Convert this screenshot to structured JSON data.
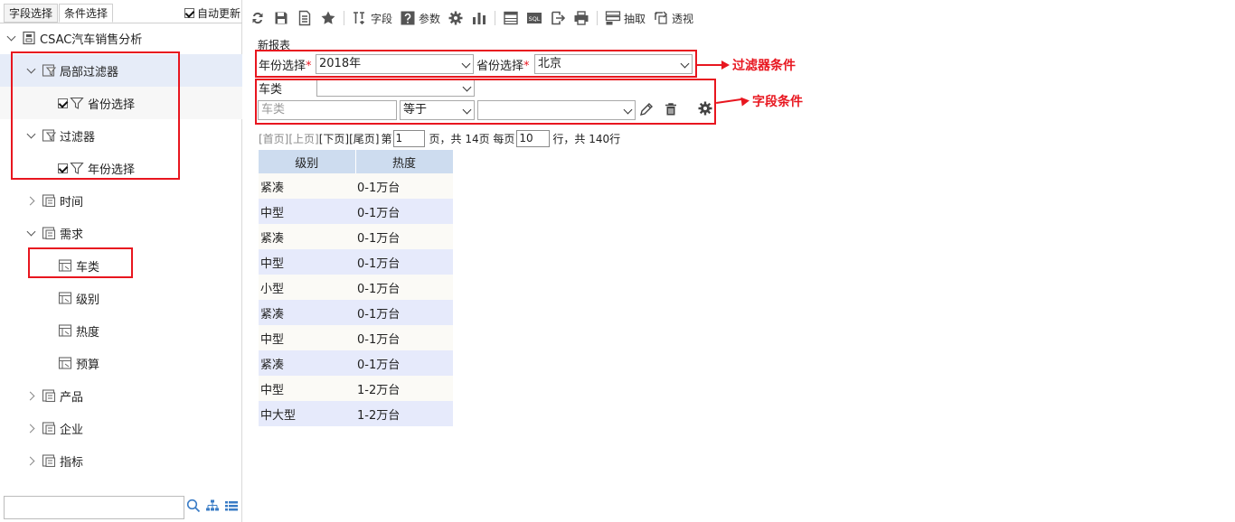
{
  "left_panel": {
    "tabs": [
      "字段选择",
      "条件选择"
    ],
    "auto_update_label": "自动更新",
    "tree": {
      "root": "CSAC汽车销售分析",
      "local_filter": "局部过滤器",
      "local_filter_child": "省份选择",
      "filter": "过滤器",
      "filter_child": "年份选择",
      "time": "时间",
      "demand": "需求",
      "demand_children": [
        "车类",
        "级别",
        "热度",
        "预算"
      ],
      "product": "产品",
      "enterprise": "企业",
      "indicator": "指标"
    }
  },
  "toolbar": {
    "field_label": "字段",
    "param_label": "参数",
    "extract_label": "抽取",
    "pivot_label": "透视",
    "sql_label": "SQL"
  },
  "report": {
    "title": "新报表",
    "year_label": "年份选择",
    "year_value": "2018年",
    "province_label": "省份选择",
    "province_value": "北京",
    "required_mark": "*",
    "car_type_label": "车类",
    "car_type_value": "",
    "cond_field_placeholder": "车类",
    "cond_operator": "等于",
    "cond_value": ""
  },
  "annotations": {
    "filter_conditions": "过滤器条件",
    "field_conditions": "字段条件"
  },
  "pager": {
    "first": "[首页]",
    "prev": "[上页]",
    "next": "[下页]",
    "last": "[尾页]",
    "page_prefix": "第",
    "page": "1",
    "page_suffix": "页，共 14页 每页",
    "page_size": "10",
    "rows_suffix": "行，共 140行"
  },
  "table": {
    "columns": [
      "级别",
      "热度"
    ],
    "rows": [
      [
        "紧凑",
        "0-1万台"
      ],
      [
        "中型",
        "0-1万台"
      ],
      [
        "紧凑",
        "0-1万台"
      ],
      [
        "中型",
        "0-1万台"
      ],
      [
        "小型",
        "0-1万台"
      ],
      [
        "紧凑",
        "0-1万台"
      ],
      [
        "中型",
        "0-1万台"
      ],
      [
        "紧凑",
        "0-1万台"
      ],
      [
        "中型",
        "1-2万台"
      ],
      [
        "中大型",
        "1-2万台"
      ]
    ]
  },
  "colors": {
    "annotation_red": "#e8161f",
    "header_blue": "#cddcef",
    "row_alt": "#e6eafb",
    "selected": "#e6ecf8"
  }
}
